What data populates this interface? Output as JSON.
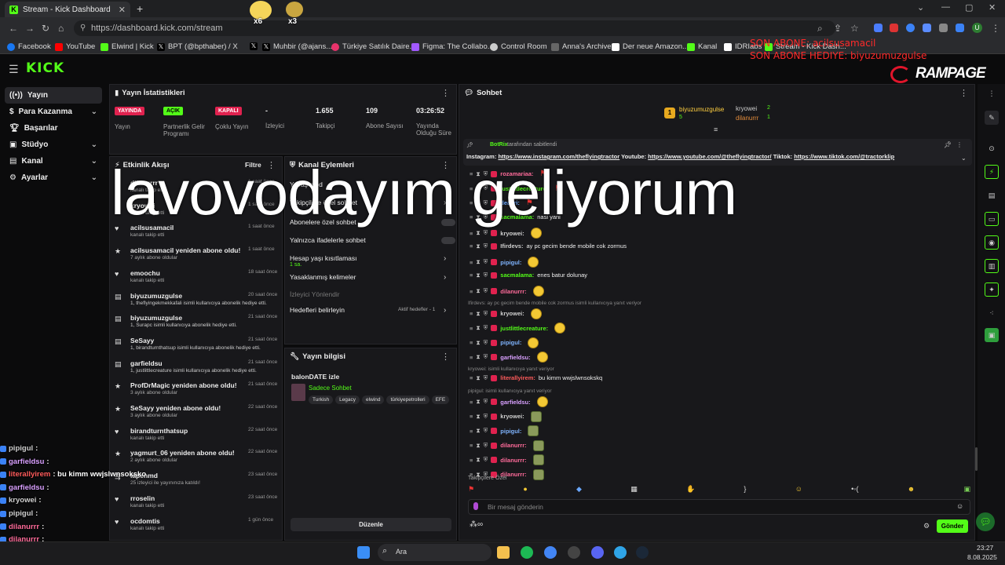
{
  "browser": {
    "tab_title": "Stream - Kick Dashboard",
    "url": "https://dashboard.kick.com/stream",
    "bookmarks": [
      "Facebook",
      "YouTube",
      "Elwind | Kick",
      "BPT (@bpthaber) / X",
      "",
      "Muhbir (@ajans...",
      "Türkiye Satılık Daire...",
      "Figma: The Collabo...",
      "Control Room",
      "Anna's Archive",
      "Der neue Amazon...",
      "Kanal",
      "IDRIabs",
      "Stream - Kick Dash..."
    ]
  },
  "overlay": {
    "sub_new": "SON ABONE: acilsusamacil",
    "sub_gift": "SON ABONE HEDIYE: biyuzumuzgulse",
    "brand": "RAMPAGE",
    "big_text": "lavovodayım geliyorum",
    "sticker1": "x6",
    "sticker2": "x3",
    "chat": [
      {
        "user": "pipigul",
        "text": " : ",
        "color": "#cfcfcf"
      },
      {
        "user": "garfieldsu",
        "text": " : ",
        "color": "#d9a0ff"
      },
      {
        "user": "literallyirem",
        "text": " : bu kimm wwjslwnsoksko",
        "color": "#ff5b5b"
      },
      {
        "user": "garfieldsu",
        "text": " : ",
        "color": "#d9a0ff"
      },
      {
        "user": "kryowei",
        "text": " : ",
        "color": "#cfcfcf"
      },
      {
        "user": "pipigul",
        "text": " : ",
        "color": "#cfcfcf"
      },
      {
        "user": "dilanurrr",
        "text": " : ",
        "color": "#ff6b9a"
      },
      {
        "user": "dilanurrr",
        "text": " : ",
        "color": "#ff6b9a"
      },
      {
        "user": "dilanurrr",
        "text": " : ",
        "color": "#ff6b9a"
      }
    ]
  },
  "sidebar": {
    "items": [
      {
        "label": "Yayın",
        "chev": false
      },
      {
        "label": "Para Kazanma",
        "chev": true
      },
      {
        "label": "Başarılar",
        "chev": false
      },
      {
        "label": "Stüdyo",
        "chev": true
      },
      {
        "label": "Kanal",
        "chev": true
      },
      {
        "label": "Ayarlar",
        "chev": true
      }
    ]
  },
  "stats": {
    "title": "Yayın İstatistikleri",
    "items": [
      {
        "badge": "YAYINDA",
        "badge_bg": "#e0224f",
        "badge_fg": "#fff",
        "label": "Yayın"
      },
      {
        "badge": "AÇIK",
        "badge_bg": "#53fc18",
        "badge_fg": "#000",
        "label": "Partnerlik Gelir Programı"
      },
      {
        "badge": "KAPALI",
        "badge_bg": "#e0224f",
        "badge_fg": "#fff",
        "label": "Çoklu Yayın"
      },
      {
        "value": "-",
        "label": "İzleyici"
      },
      {
        "value": "1.655",
        "label": "Takipçi"
      },
      {
        "value": "109",
        "label": "Abone Sayısı"
      },
      {
        "value": "03:26:52",
        "label": "Yayında Olduğu Süre"
      }
    ]
  },
  "activity": {
    "title": "Etkinlik Akışı",
    "filter": "Filtre",
    "events": [
      {
        "name": "dilanurrr",
        "sub": "kanalı takip etti",
        "time": "1 saat önce",
        "icon": "heart"
      },
      {
        "name": "kryowei",
        "sub": "kanalı takip etti",
        "time": "1 saat önce",
        "icon": "heart"
      },
      {
        "name": "acilsusamacil",
        "sub": "kanalı takip etti",
        "time": "1 saat önce",
        "icon": "heart"
      },
      {
        "name": "acilsusamacil yeniden abone oldu!",
        "sub": "7 aylık abone oldular",
        "time": "1 saat önce",
        "icon": "star"
      },
      {
        "name": "emoochu",
        "sub": "kanalı takip etti",
        "time": "18 saat önce",
        "icon": "heart"
      },
      {
        "name": "biyuzumuzgulse",
        "sub": "1, theflyingekmekkafali isimli kullanıcıya abonelik hediye etti.",
        "time": "20 saat önce",
        "icon": "gift"
      },
      {
        "name": "biyuzumuzgulse",
        "sub": "1, Surapc isimli kullanıcıya abonelik hediye etti.",
        "time": "21 saat önce",
        "icon": "gift"
      },
      {
        "name": "SeSayy",
        "sub": "1, birandturnthatsup isimli kullanıcıya abonelik hediye etti.",
        "time": "21 saat önce",
        "icon": "gift"
      },
      {
        "name": "garfieldsu",
        "sub": "1, justlittlecreature isimli kullanıcıya abonelik hediye etti.",
        "time": "21 saat önce",
        "icon": "gift"
      },
      {
        "name": "ProfDrMagic yeniden abone oldu!",
        "sub": "3 aylık abone oldular",
        "time": "21 saat önce",
        "icon": "star"
      },
      {
        "name": "SeSayy yeniden abone oldu!",
        "sub": "3 aylık abone oldular",
        "time": "22 saat önce",
        "icon": "star"
      },
      {
        "name": "birandturnthatsup",
        "sub": "kanalı takip etti",
        "time": "22 saat önce",
        "icon": "heart"
      },
      {
        "name": "yagmurt_06 yeniden abone oldu!",
        "sub": "2 aylık abone oldular",
        "time": "22 saat önce",
        "icon": "star"
      },
      {
        "name": "lapenmd",
        "sub": "25 izleyici ile yayınınıza katıldı!",
        "time": "23 saat önce",
        "icon": "raid"
      },
      {
        "name": "rroselin",
        "sub": "kanalı takip etti",
        "time": "23 saat önce",
        "icon": "heart"
      },
      {
        "name": "ocdomtis",
        "sub": "kanalı takip etti",
        "time": "1 gün önce",
        "icon": "heart"
      }
    ]
  },
  "channel_actions": {
    "title": "Kanal Eylemleri",
    "items": [
      {
        "label": "Yavaş mod",
        "type": "chev"
      },
      {
        "label": "Takipçilere özel sohbet",
        "type": "chev"
      },
      {
        "label": "Abonelere özel sohbet",
        "type": "toggle"
      },
      {
        "label": "Yalnızca ifadelerle sohbet",
        "type": "toggle"
      },
      {
        "label": "Hesap yaşı kısıtlaması",
        "type": "chev",
        "sub": "1 sa."
      },
      {
        "label": "Yasaklanmış kelimeler",
        "type": "chev"
      },
      {
        "label": "İzleyici Yönlendir",
        "type": "none"
      },
      {
        "label": "Hedefleri belirleyin",
        "type": "chev",
        "extra": "Aktif hedefler - 1"
      }
    ]
  },
  "stream_info": {
    "title": "Yayın bilgisi",
    "stream_title": "balonDATE izle",
    "category": "Sadece Sohbet",
    "tags": [
      "Turkish",
      "Legacy",
      "elwind",
      "türkiyepetrolleri",
      "EFE"
    ],
    "edit": "Düzenle"
  },
  "chat": {
    "title": "Sohbet",
    "top_gifters": [
      {
        "name": "biyuzumuzgulse",
        "count": "5"
      },
      {
        "name": "kryowei",
        "count": "2"
      },
      {
        "name": "dilanurrr",
        "count": "1"
      }
    ],
    "pinned_by": "BotRix",
    "pinned_suffix": "tarafından sabitlendi",
    "pinned_prefix1": "Instagram: ",
    "pinned_link1": "https://www.instagram.com/theflyingtractor",
    "pinned_prefix2": " Youtube: ",
    "pinned_link2": "https://www.youtube.com/@theflyingtractor/",
    "pinned_prefix3": " Tiktok: ",
    "pinned_link3": "https://www.tiktok.com/@tractorklip",
    "messages": [
      {
        "user": "rozamariaa:",
        "text": "",
        "color": "#ff6b9a",
        "emote": "flag"
      },
      {
        "user": "justlittlecreature:",
        "text": "",
        "color": "#53fc18",
        "emote": "flag"
      },
      {
        "user": "deaeri:",
        "text": "",
        "color": "#6aa8ff",
        "emote": "flag"
      },
      {
        "user": "sacmalama:",
        "text": "nasi yani",
        "color": "#53fc18",
        "emote": ""
      },
      {
        "user": "kryowei:",
        "text": "",
        "color": "#cfcfcf",
        "emote": "face"
      },
      {
        "user": "Ifirdevs:",
        "text": "ay pc gecim bende mobile cok zormus",
        "color": "#cfcfcf",
        "emote": ""
      },
      {
        "user": "pipigul:",
        "text": "",
        "color": "#7fb4ff",
        "emote": "face"
      },
      {
        "user": "sacmalama:",
        "text": "enes batur dolunay",
        "color": "#53fc18",
        "emote": ""
      },
      {
        "user": "dilanurrr:",
        "text": "",
        "color": "#ff6b9a",
        "emote": "face"
      },
      {
        "user": "kryowei:",
        "text": "",
        "color": "#cfcfcf",
        "emote": "face",
        "reply": "Ifirdevs: ay pc gecim bende mobile cok zormus isimli kullanıcıya yanıt veriyor"
      },
      {
        "user": "justlittlecreature:",
        "text": "",
        "color": "#53fc18",
        "emote": "face"
      },
      {
        "user": "pipigul:",
        "text": "",
        "color": "#7fb4ff",
        "emote": "face"
      },
      {
        "user": "garfieldsu:",
        "text": "",
        "color": "#d9a0ff",
        "emote": "face"
      },
      {
        "user": "literallyirem:",
        "text": "bu kimm wwjslwnsokskq",
        "color": "#ff5b5b",
        "emote": "",
        "reply": "kryowei: isimli kullanıcıya yanıt veriyor"
      },
      {
        "user": "garfieldsu:",
        "text": "",
        "color": "#d9a0ff",
        "emote": "face",
        "reply": "pipigul: isimli kullanıcıya yanıt veriyor"
      },
      {
        "user": "kryowei:",
        "text": "",
        "color": "#cfcfcf",
        "emote": "dog"
      },
      {
        "user": "pipigul:",
        "text": "",
        "color": "#7fb4ff",
        "emote": "dog"
      },
      {
        "user": "dilanurrr:",
        "text": "",
        "color": "#ff6b9a",
        "emote": "dog"
      },
      {
        "user": "dilanurrr:",
        "text": "",
        "color": "#ff6b9a",
        "emote": "dog"
      },
      {
        "user": "dilanurrr:",
        "text": "",
        "color": "#ff6b9a",
        "emote": "dog"
      }
    ],
    "mode_label": "Takipçilere Özel",
    "input_placeholder": "Bir mesaj gönderin",
    "send": "Gönder"
  },
  "taskbar": {
    "search": "Ara",
    "time": "23:27",
    "date": "8.08.2025"
  },
  "colors": {
    "accent": "#53fc18",
    "live": "#e0224f"
  }
}
